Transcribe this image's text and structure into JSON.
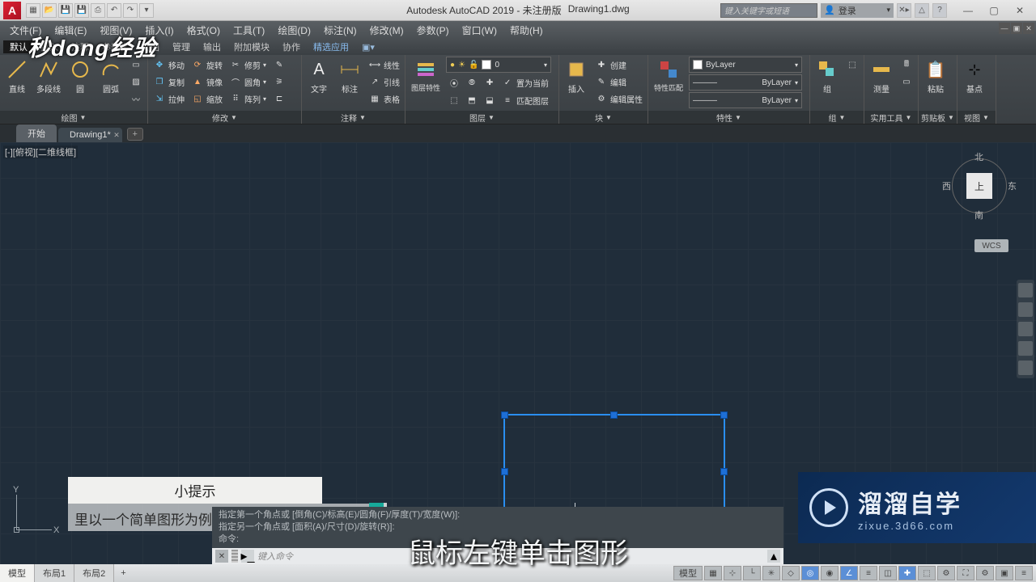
{
  "app": {
    "logo_letter": "A",
    "title_app": "Autodesk AutoCAD 2019 - 未注册版",
    "title_file": "Drawing1.dwg",
    "search_placeholder": "键入关键字或短语",
    "login_label": "登录",
    "win_min": "—",
    "win_max": "▢",
    "win_close": "✕"
  },
  "menubar": [
    "文件(F)",
    "编辑(E)",
    "视图(V)",
    "插入(I)",
    "格式(O)",
    "工具(T)",
    "绘图(D)",
    "标注(N)",
    "修改(M)",
    "参数(P)",
    "窗口(W)",
    "帮助(H)"
  ],
  "subtabs": {
    "items": [
      "默认",
      "插入",
      "注释",
      "参数化",
      "视图",
      "管理",
      "输出",
      "附加模块",
      "协作",
      "精选应用"
    ],
    "active_index": 0,
    "highlight_index": 9
  },
  "ribbon": {
    "draw": {
      "label": "绘图",
      "line": "直线",
      "pline": "多段线",
      "circle": "圆",
      "arc": "圆弧"
    },
    "modify": {
      "label": "修改",
      "move": "移动",
      "copy": "复制",
      "stretch": "拉伸",
      "rotate": "旋转",
      "mirror": "镜像",
      "scale": "缩放",
      "trim": "修剪",
      "fillet": "圆角",
      "array": "阵列"
    },
    "annot": {
      "label": "注释",
      "text": "文字",
      "dim": "标注",
      "leader": "引线",
      "table": "表格",
      "linear": "线性"
    },
    "layer": {
      "label": "图层",
      "props": "图层特性",
      "current": "0",
      "setcurrent": "置为当前",
      "match": "匹配图层"
    },
    "block": {
      "label": "块",
      "insert": "插入",
      "create": "创建",
      "edit": "编辑",
      "editattr": "编辑属性"
    },
    "props": {
      "label": "特性",
      "match": "特性匹配",
      "bylayer": "ByLayer"
    },
    "group": {
      "label": "组",
      "group": "组"
    },
    "util": {
      "label": "实用工具",
      "measure": "测量"
    },
    "clip": {
      "label": "剪贴板",
      "paste": "粘贴"
    },
    "view": {
      "label": "视图",
      "base": "基点"
    }
  },
  "filetabs": {
    "start": "开始",
    "drawing": "Drawing1*"
  },
  "canvas": {
    "view_label": "[-][俯视][二维线框]",
    "viewcube": {
      "top": "上",
      "n": "北",
      "s": "南",
      "e": "东",
      "w": "西"
    },
    "wcs": "WCS",
    "ucs": {
      "x": "X",
      "y": "Y"
    }
  },
  "tooltip": {
    "title": "小提示",
    "body": "里以一个简单图形为例"
  },
  "command": {
    "hist1": "指定第一个角点或 [倒角(C)/标高(E)/圆角(F)/厚度(T)/宽度(W)]:",
    "hist2": "指定另一个角点或 [面积(A)/尺寸(D)/旋转(R)]:",
    "hist3": "命令:",
    "prompt": "键入命令"
  },
  "status": {
    "layouts": [
      "模型",
      "布局1",
      "布局2"
    ],
    "model": "模型"
  },
  "overlay": {
    "watermark": "秒dong经验",
    "subtitle": "鼠标左键单击图形",
    "brand": "溜溜自学",
    "brand_sub": "zixue.3d66.com"
  }
}
